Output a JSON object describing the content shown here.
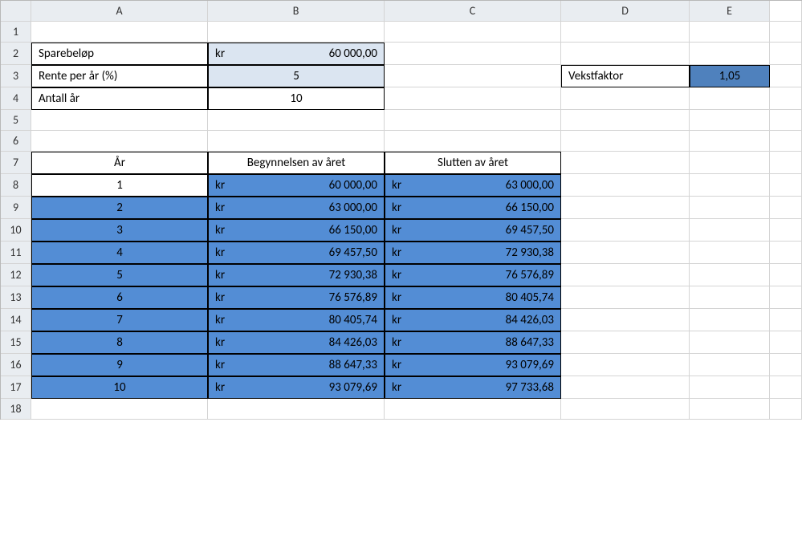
{
  "headers": {
    "cols": [
      "A",
      "B",
      "C",
      "D",
      "E"
    ],
    "rows": [
      "1",
      "2",
      "3",
      "4",
      "5",
      "6",
      "7",
      "8",
      "9",
      "10",
      "11",
      "12",
      "13",
      "14",
      "15",
      "16",
      "17",
      "18"
    ]
  },
  "inputs": {
    "sparebelop_label": "Sparebeløp",
    "sparebelop_unit": "kr",
    "sparebelop_value": "60 000,00",
    "rente_label": "Rente per år (%)",
    "rente_value": "5",
    "antall_label": "Antall år",
    "antall_value": "10",
    "vekstfaktor_label": "Vekstfaktor",
    "vekstfaktor_value": "1,05"
  },
  "table": {
    "header_year": "År",
    "header_begin": "Begynnelsen av året",
    "header_end": "Slutten av året",
    "unit": "kr",
    "rows": [
      {
        "year": "1",
        "begin": "60 000,00",
        "end": "63 000,00"
      },
      {
        "year": "2",
        "begin": "63 000,00",
        "end": "66 150,00"
      },
      {
        "year": "3",
        "begin": "66 150,00",
        "end": "69 457,50"
      },
      {
        "year": "4",
        "begin": "69 457,50",
        "end": "72 930,38"
      },
      {
        "year": "5",
        "begin": "72 930,38",
        "end": "76 576,89"
      },
      {
        "year": "6",
        "begin": "76 576,89",
        "end": "80 405,74"
      },
      {
        "year": "7",
        "begin": "80 405,74",
        "end": "84 426,03"
      },
      {
        "year": "8",
        "begin": "84 426,03",
        "end": "88 647,33"
      },
      {
        "year": "9",
        "begin": "88 647,33",
        "end": "93 079,69"
      },
      {
        "year": "10",
        "begin": "93 079,69",
        "end": "97 733,68"
      }
    ]
  }
}
